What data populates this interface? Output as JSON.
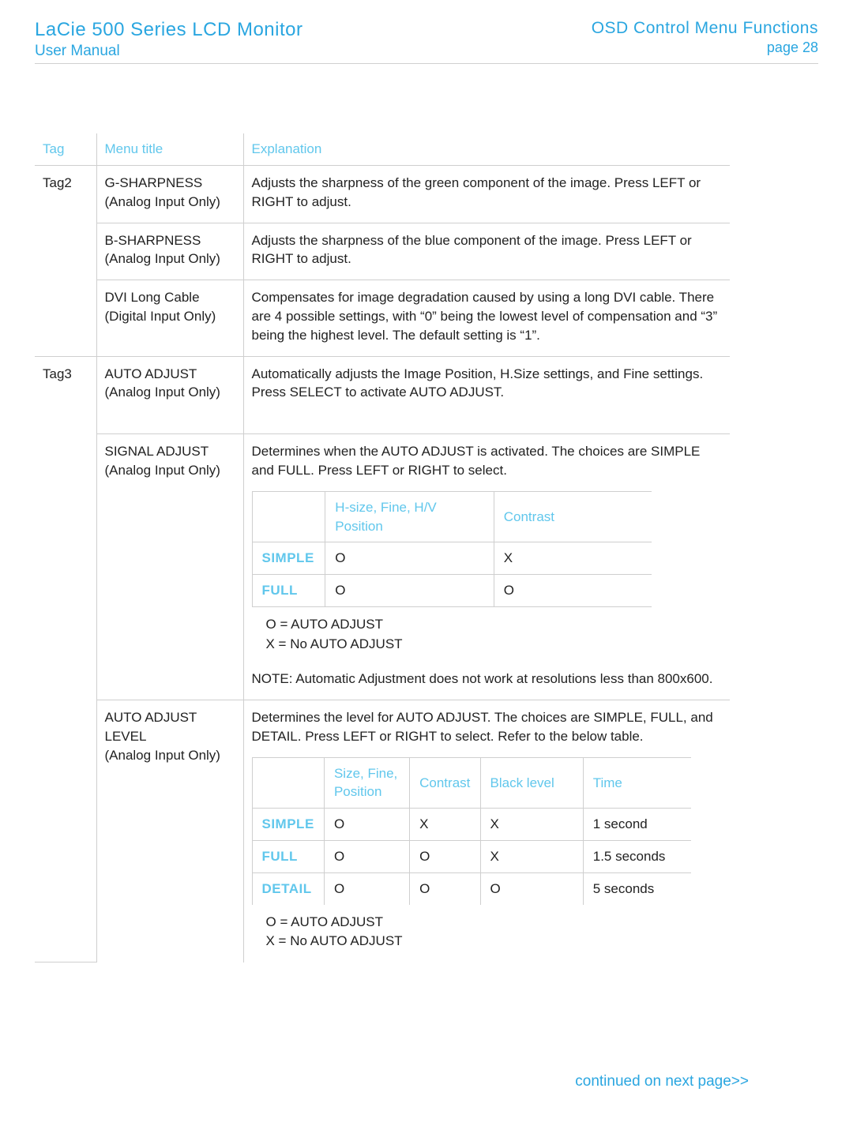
{
  "header": {
    "title_left": "LaCie 500 Series LCD Monitor",
    "subtitle_left": "User Manual",
    "title_right": "OSD Control Menu Functions",
    "subtitle_right": "page 28"
  },
  "columns": {
    "tag": "Tag",
    "menu_title": "Menu title",
    "explanation": "Explanation"
  },
  "rows": {
    "r0": {
      "tag": "Tag2",
      "mt1": "G-SHARPNESS",
      "mt2": "(Analog Input Only)",
      "exp": "Adjusts the sharpness of the green component of the image.  Press LEFT or RIGHT to adjust."
    },
    "r1": {
      "mt1": "B-SHARPNESS",
      "mt2": "(Analog Input Only)",
      "exp": "Adjusts the sharpness of the blue component of the image.  Press LEFT or RIGHT to adjust."
    },
    "r2": {
      "mt1": "DVI Long Cable",
      "mt2": "(Digital Input Only)",
      "exp": "Compensates for image degradation caused by using a long DVI cable.  There are 4 possible settings, with “0” being the lowest level of compensation and “3” being the highest level. The default setting is “1”."
    },
    "r3": {
      "tag": "Tag3",
      "mt1": "AUTO ADJUST",
      "mt2": "(Analog Input Only)",
      "exp": "Automatically adjusts the Image Position, H.Size settings, and Fine settings.  Press SELECT to activate AUTO ADJUST."
    },
    "r4": {
      "mt1": "SIGNAL ADJUST",
      "mt2": "(Analog Input Only)",
      "exp": "Determines when the AUTO ADJUST is activated.  The choices are SIMPLE and FULL. Press LEFT or RIGHT to select.",
      "table": {
        "head": {
          "c1": "H-size, Fine, H/V Position",
          "c2": "Contrast"
        },
        "rows": {
          "simple": {
            "label": "SIMPLE",
            "c1": "O",
            "c2": "X"
          },
          "full": {
            "label": "FULL",
            "c1": "O",
            "c2": "O"
          }
        }
      },
      "legend1": "O = AUTO ADJUST",
      "legend2": "X = No AUTO ADJUST",
      "note": "NOTE:  Automatic Adjustment does not work at resolutions less than 800x600."
    },
    "r5": {
      "mt1": "AUTO ADJUST LEVEL",
      "mt2": "(Analog Input Only)",
      "exp": "Determines the level for AUTO ADJUST. The choices are SIMPLE, FULL, and DETAIL. Press LEFT or RIGHT to select. Refer to the below table.",
      "table": {
        "head": {
          "c1": "Size, Fine, Position",
          "c2": "Contrast",
          "c3": "Black level",
          "c4": "Time"
        },
        "rows": {
          "simple": {
            "label": "SIMPLE",
            "c1": "O",
            "c2": "X",
            "c3": "X",
            "c4": "1 second"
          },
          "full": {
            "label": "FULL",
            "c1": "O",
            "c2": "O",
            "c3": "X",
            "c4": "1.5 seconds"
          },
          "detail": {
            "label": "DETAIL",
            "c1": "O",
            "c2": "O",
            "c3": "O",
            "c4": "5 seconds"
          }
        }
      },
      "legend1": "O = AUTO ADJUST",
      "legend2": "X = No AUTO ADJUST"
    }
  },
  "continued": "continued on next page>>"
}
